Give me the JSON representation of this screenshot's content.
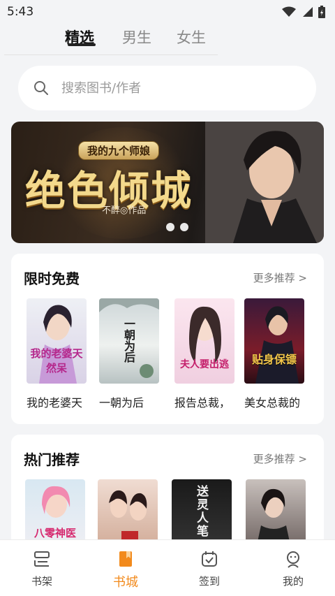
{
  "status_bar": {
    "time": "5:43"
  },
  "tabs": [
    {
      "label": "精选",
      "active": true
    },
    {
      "label": "男生",
      "active": false
    },
    {
      "label": "女生",
      "active": false
    }
  ],
  "search": {
    "placeholder": "搜索图书/作者"
  },
  "banner": {
    "subtitle": "我的九个师娘",
    "title": "绝色倾城",
    "author": "不醉◎作品",
    "dots": 2
  },
  "sections": {
    "free": {
      "title": "限时免费",
      "more": "更多推荐 >",
      "books": [
        {
          "title": "我的老婆天",
          "cover_text": "我的老婆天然呆"
        },
        {
          "title": "一朝为后",
          "cover_text": "一朝为后"
        },
        {
          "title": "报告总裁，",
          "cover_text": "夫人要出逃"
        },
        {
          "title": "美女总裁的",
          "cover_text": "贴身保镖"
        }
      ]
    },
    "hot": {
      "title": "热门推荐",
      "more": "更多推荐 >",
      "books": [
        {
          "cover_text": "八零神医"
        },
        {
          "cover_text": ""
        },
        {
          "cover_text": "送灵人笔"
        },
        {
          "cover_text": ""
        }
      ]
    }
  },
  "bottom_nav": [
    {
      "label": "书架",
      "icon": "bookshelf-icon",
      "active": false
    },
    {
      "label": "书城",
      "icon": "bookstore-icon",
      "active": true
    },
    {
      "label": "签到",
      "icon": "checkin-icon",
      "active": false
    },
    {
      "label": "我的",
      "icon": "profile-icon",
      "active": false
    }
  ],
  "colors": {
    "accent": "#f28a1c",
    "background": "#f3f4f6",
    "card": "#ffffff"
  }
}
